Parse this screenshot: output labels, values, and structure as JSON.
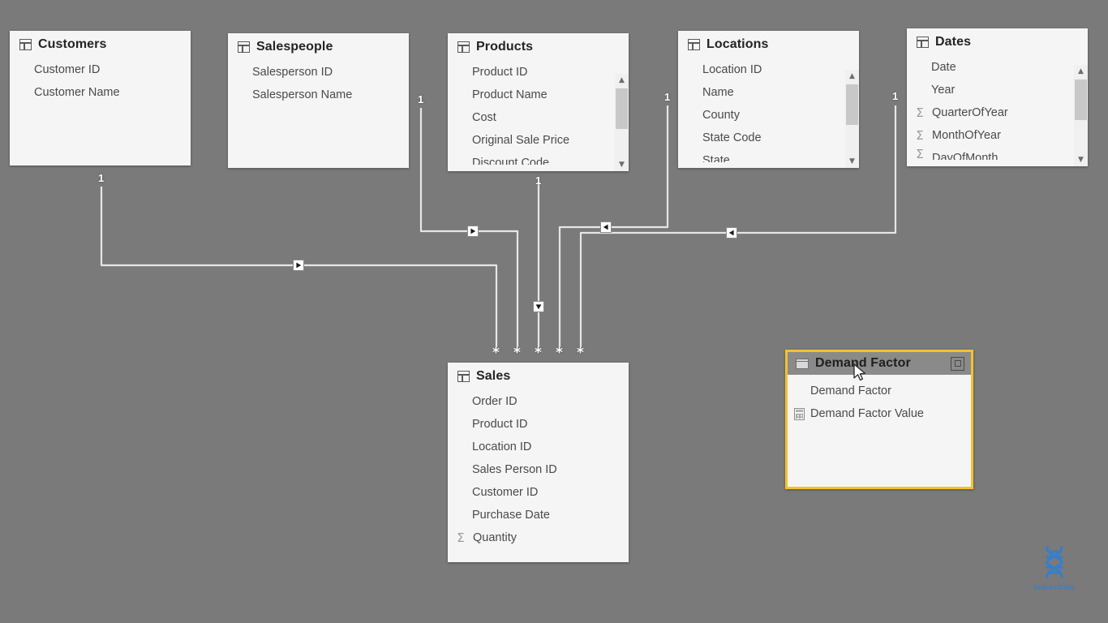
{
  "app": {
    "view": "Model view",
    "canvas_background": "#7a7a7a"
  },
  "colors": {
    "table_background": "#f5f5f5",
    "table_title": "#252423",
    "field_text": "#4a4a4a",
    "selection_border": "#f2c230",
    "selected_header": "#8a8a8a",
    "relationship_line": "#e8e8e8",
    "watermark": "#2f7fd6"
  },
  "tables": [
    {
      "id": "customers",
      "name": "Customers",
      "icon": "table-icon",
      "selected": false,
      "scrollbar": false,
      "fields": [
        {
          "name": "Customer ID",
          "icon": null
        },
        {
          "name": "Customer Name",
          "icon": null
        }
      ]
    },
    {
      "id": "salespeople",
      "name": "Salespeople",
      "icon": "table-icon",
      "selected": false,
      "scrollbar": false,
      "fields": [
        {
          "name": "Salesperson ID",
          "icon": null
        },
        {
          "name": "Salesperson Name",
          "icon": null
        }
      ]
    },
    {
      "id": "products",
      "name": "Products",
      "icon": "table-icon",
      "selected": false,
      "scrollbar": true,
      "fields": [
        {
          "name": "Product ID",
          "icon": null
        },
        {
          "name": "Product Name",
          "icon": null
        },
        {
          "name": "Cost",
          "icon": null
        },
        {
          "name": "Original Sale Price",
          "icon": null
        },
        {
          "name": "Discount Code",
          "icon": null,
          "clipped": true
        }
      ]
    },
    {
      "id": "locations",
      "name": "Locations",
      "icon": "table-icon",
      "selected": false,
      "scrollbar": true,
      "fields": [
        {
          "name": "Location ID",
          "icon": null
        },
        {
          "name": "Name",
          "icon": null
        },
        {
          "name": "County",
          "icon": null
        },
        {
          "name": "State Code",
          "icon": null
        },
        {
          "name": "State",
          "icon": null,
          "clipped": true
        }
      ]
    },
    {
      "id": "dates",
      "name": "Dates",
      "icon": "table-icon",
      "selected": false,
      "scrollbar": true,
      "fields": [
        {
          "name": "Date",
          "icon": null
        },
        {
          "name": "Year",
          "icon": null
        },
        {
          "name": "QuarterOfYear",
          "icon": "sigma-icon"
        },
        {
          "name": "MonthOfYear",
          "icon": "sigma-icon"
        },
        {
          "name": "DayOfMonth",
          "icon": "sigma-icon",
          "clipped": true
        }
      ]
    },
    {
      "id": "sales",
      "name": "Sales",
      "icon": "table-icon",
      "selected": false,
      "scrollbar": false,
      "fields": [
        {
          "name": "Order ID",
          "icon": null
        },
        {
          "name": "Product ID",
          "icon": null
        },
        {
          "name": "Location ID",
          "icon": null
        },
        {
          "name": "Sales Person ID",
          "icon": null
        },
        {
          "name": "Customer ID",
          "icon": null
        },
        {
          "name": "Purchase Date",
          "icon": null
        },
        {
          "name": "Quantity",
          "icon": "sigma-icon"
        }
      ]
    },
    {
      "id": "demand-factor",
      "name": "Demand Factor",
      "icon": "table-icon",
      "selected": true,
      "scrollbar": false,
      "expand_icon": "expand-icon",
      "fields": [
        {
          "name": "Demand Factor",
          "icon": null
        },
        {
          "name": "Demand Factor Value",
          "icon": "calculator-icon"
        }
      ]
    }
  ],
  "relationships": [
    {
      "from": "Customers",
      "to": "Sales",
      "one_label": "1",
      "many_label": "*",
      "cross_filter": "single"
    },
    {
      "from": "Salespeople",
      "to": "Sales",
      "one_label": "1",
      "many_label": "*",
      "cross_filter": "single"
    },
    {
      "from": "Products",
      "to": "Sales",
      "one_label": "1",
      "many_label": "*",
      "cross_filter": "single"
    },
    {
      "from": "Locations",
      "to": "Sales",
      "one_label": "1",
      "many_label": "*",
      "cross_filter": "single"
    },
    {
      "from": "Dates",
      "to": "Sales",
      "one_label": "1",
      "many_label": "*",
      "cross_filter": "single"
    }
  ],
  "cardinality_labels": {
    "one": "1",
    "many": "*"
  },
  "watermark": {
    "label": "SUBSCRIBE",
    "icon": "dna-icon"
  }
}
